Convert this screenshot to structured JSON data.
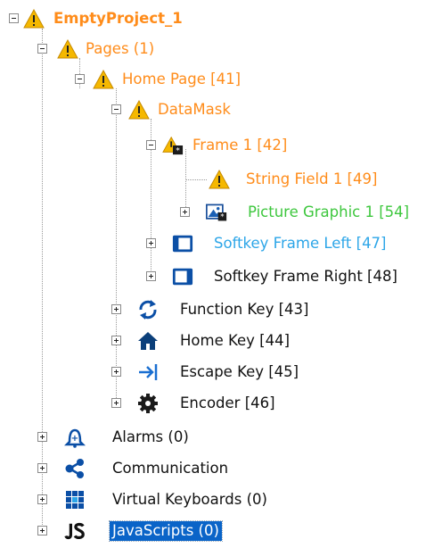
{
  "tree": {
    "root": {
      "label": "EmptyProject_1",
      "icon": "warning-icon"
    },
    "pages": {
      "label": "Pages (1)",
      "icon": "warning-icon"
    },
    "home_page": {
      "label": "Home Page [41]",
      "icon": "warning-icon"
    },
    "datamask": {
      "label": "DataMask",
      "icon": "warning-icon"
    },
    "frame1": {
      "label": "Frame 1 [42]",
      "icon": "frame-warning-icon"
    },
    "string_field": {
      "label": "String Field 1 [49]",
      "icon": "warning-icon"
    },
    "picture_graphic": {
      "label": "Picture Graphic 1 [54]",
      "icon": "picture-icon"
    },
    "softkey_left": {
      "label": "Softkey Frame Left [47]",
      "icon": "softkey-left-icon"
    },
    "softkey_right": {
      "label": "Softkey Frame Right [48]",
      "icon": "softkey-right-icon"
    },
    "function_key": {
      "label": "Function Key [43]",
      "icon": "refresh-icon"
    },
    "home_key": {
      "label": "Home Key [44]",
      "icon": "home-icon"
    },
    "escape_key": {
      "label": "Escape Key [45]",
      "icon": "escape-icon"
    },
    "encoder": {
      "label": "Encoder [46]",
      "icon": "gear-icon"
    },
    "alarms": {
      "label": "Alarms (0)",
      "icon": "bell-icon"
    },
    "communication": {
      "label": "Communication",
      "icon": "share-icon"
    },
    "virtual_keyboards": {
      "label": "Virtual Keyboards (0)",
      "icon": "keyboard-icon"
    },
    "javascripts": {
      "label": "JavaScripts (0)",
      "icon": "js-icon"
    }
  },
  "colors": {
    "warning": "#ff8c1a",
    "green": "#3ec73e",
    "blue": "#2da6e8",
    "selection": "#0a64c8"
  }
}
